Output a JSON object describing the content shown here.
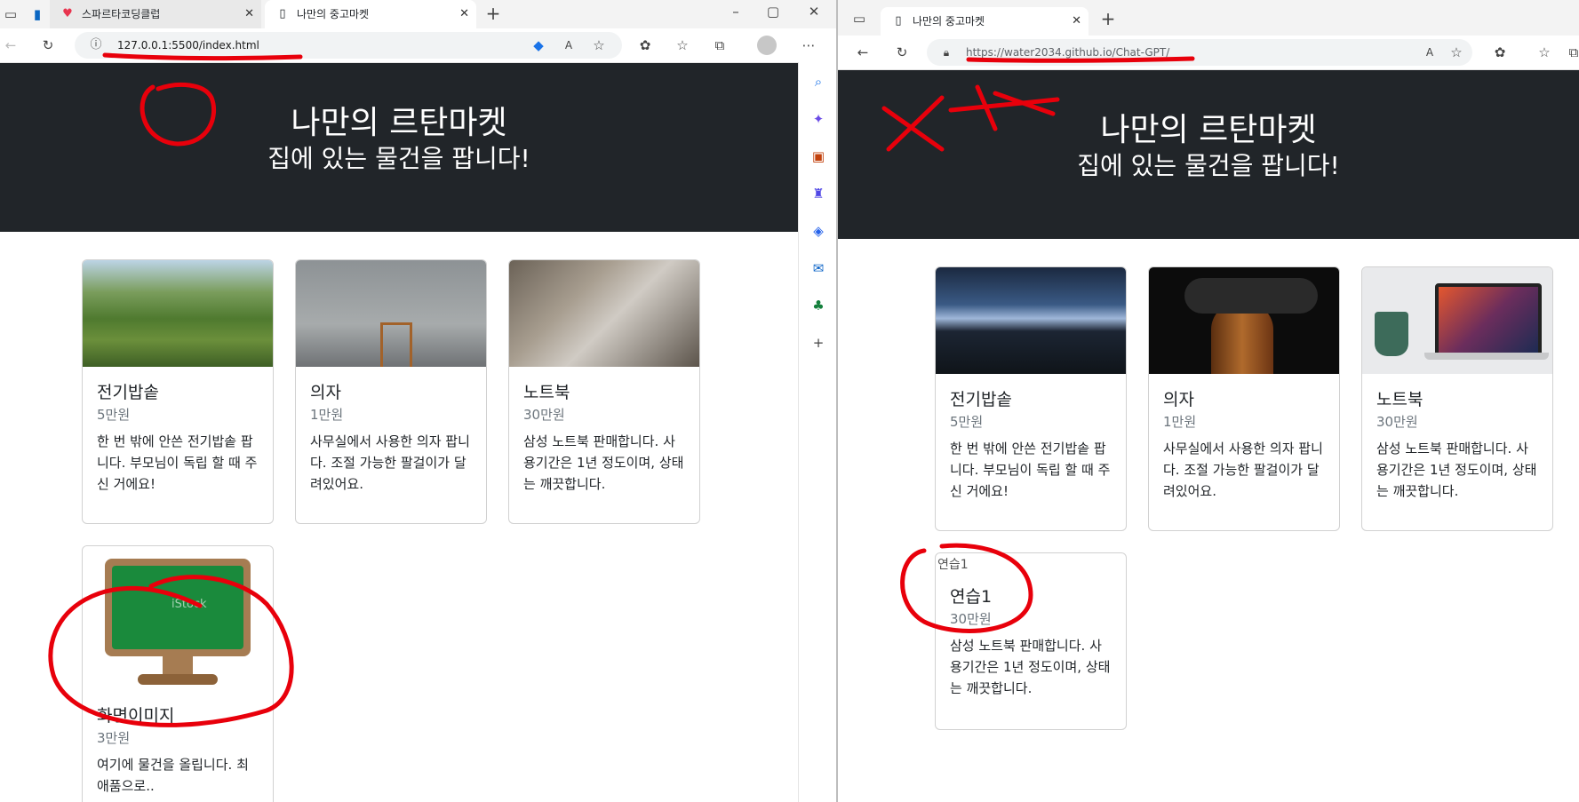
{
  "left_window": {
    "tabs": [
      {
        "title": "스파르타코딩클럽",
        "favicon": "sparta-favicon"
      },
      {
        "title": "나만의 중고마켓",
        "favicon": "page-icon"
      }
    ],
    "url": "127.0.0.1:5500/index.html",
    "hero": {
      "title": "나만의 르탄마켓",
      "subtitle": "집에 있는 물건을 팝니다!"
    },
    "cards": [
      {
        "title": "전기밥솥",
        "price": "5만원",
        "desc": "한 번 밖에 안쓴 전기밥솥 팝니다. 부모님이 독립 할 때 주신 거에요!"
      },
      {
        "title": "의자",
        "price": "1만원",
        "desc": "사무실에서 사용한 의자 팝니다. 조절 가능한 팔걸이가 달려있어요."
      },
      {
        "title": "노트북",
        "price": "30만원",
        "desc": "삼성 노트북 판매합니다. 사용기간은 1년 정도이며, 상태는 깨끗합니다."
      },
      {
        "title": "화면이미지",
        "price": "3만원",
        "desc": "여기에 물건을 올립니다. 최애품으로.."
      }
    ],
    "watermark": "iStock"
  },
  "right_window": {
    "tabs": [
      {
        "title": "나만의 중고마켓",
        "favicon": "page-icon"
      }
    ],
    "url": "https://water2034.github.io/Chat-GPT/",
    "hero": {
      "title": "나만의 르탄마켓",
      "subtitle": "집에 있는 물건을 팝니다!"
    },
    "cards": [
      {
        "title": "전기밥솥",
        "price": "5만원",
        "desc": "한 번 밖에 안쓴 전기밥솥 팝니다. 부모님이 독립 할 때 주신 거에요!"
      },
      {
        "title": "의자",
        "price": "1만원",
        "desc": "사무실에서 사용한 의자 팝니다. 조절 가능한 팔걸이가 달려있어요."
      },
      {
        "title": "노트북",
        "price": "30만원",
        "desc": "삼성 노트북 판매합니다. 사용기간은 1년 정도이며, 상태는 깨끗합니다."
      },
      {
        "title": "연습1",
        "price": "30만원",
        "desc": "삼성 노트북 판매합니다. 사용기간은 1년 정도이며, 상태는 깨끗합니다.",
        "img_alt": "연습1"
      }
    ]
  },
  "colors": {
    "hero_bg": "#212529",
    "annotation_red": "#e8000b",
    "tab_active": "#ffffff",
    "chrome_bg": "#f3f3f3"
  }
}
